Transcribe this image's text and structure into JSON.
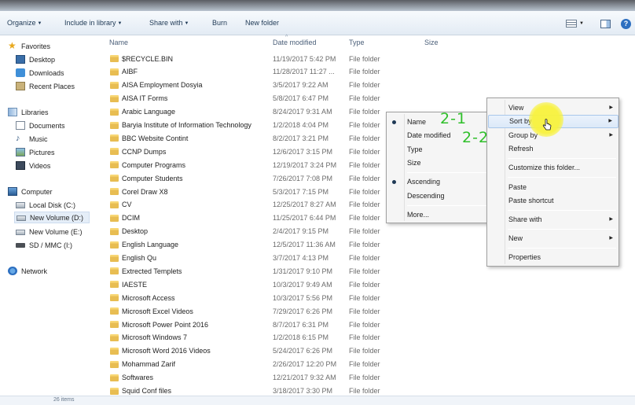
{
  "toolbar": {
    "organize": "Organize",
    "include_in_library": "Include in library",
    "share_with": "Share with",
    "burn": "Burn",
    "new_folder": "New folder"
  },
  "nav": {
    "favorites": "Favorites",
    "desktop": "Desktop",
    "downloads": "Downloads",
    "recent_places": "Recent Places",
    "libraries": "Libraries",
    "documents": "Documents",
    "music": "Music",
    "pictures": "Pictures",
    "videos": "Videos",
    "computer": "Computer",
    "local_disk": "Local Disk (C:)",
    "new_volume_d": "New Volume (D:)",
    "new_volume_e": "New Volume (E:)",
    "sd_mmc": "SD / MMC (I:)",
    "network": "Network"
  },
  "columns": {
    "name": "Name",
    "date_modified": "Date modified",
    "type": "Type",
    "size": "Size"
  },
  "files": [
    {
      "name": "$RECYCLE.BIN",
      "date": "11/19/2017 5:42 PM",
      "type": "File folder"
    },
    {
      "name": "AIBF",
      "date": "11/28/2017 11:27 ...",
      "type": "File folder"
    },
    {
      "name": "AISA Employment Dosyia",
      "date": "3/5/2017 9:22 AM",
      "type": "File folder"
    },
    {
      "name": "AISA IT Forms",
      "date": "5/8/2017 6:47 PM",
      "type": "File folder"
    },
    {
      "name": "Arabic Language",
      "date": "8/24/2017 9:31 AM",
      "type": "File folder"
    },
    {
      "name": "Baryia Institute of Information Technology",
      "date": "1/2/2018 4:04 PM",
      "type": "File folder"
    },
    {
      "name": "BBC Website Contint",
      "date": "8/2/2017 3:21 PM",
      "type": "File folder"
    },
    {
      "name": "CCNP Dumps",
      "date": "12/6/2017 3:15 PM",
      "type": "File folder"
    },
    {
      "name": "Computer Programs",
      "date": "12/19/2017 3:24 PM",
      "type": "File folder"
    },
    {
      "name": "Computer Students",
      "date": "7/26/2017 7:08 PM",
      "type": "File folder"
    },
    {
      "name": "Corel Draw X8",
      "date": "5/3/2017 7:15 PM",
      "type": "File folder"
    },
    {
      "name": "CV",
      "date": "12/25/2017 8:27 AM",
      "type": "File folder"
    },
    {
      "name": "DCIM",
      "date": "11/25/2017 6:44 PM",
      "type": "File folder"
    },
    {
      "name": "Desktop",
      "date": "2/4/2017 9:15 PM",
      "type": "File folder"
    },
    {
      "name": "English Language",
      "date": "12/5/2017 11:36 AM",
      "type": "File folder"
    },
    {
      "name": "English Qu",
      "date": "3/7/2017 4:13 PM",
      "type": "File folder"
    },
    {
      "name": "Extrected Templets",
      "date": "1/31/2017 9:10 PM",
      "type": "File folder"
    },
    {
      "name": "IAESTE",
      "date": "10/3/2017 9:49 AM",
      "type": "File folder"
    },
    {
      "name": "Microsoft Access",
      "date": "10/3/2017 5:56 PM",
      "type": "File folder"
    },
    {
      "name": "Microsoft Excel Videos",
      "date": "7/29/2017 6:26 PM",
      "type": "File folder"
    },
    {
      "name": "Microsoft Power Point 2016",
      "date": "8/7/2017 6:31 PM",
      "type": "File folder"
    },
    {
      "name": "Microsoft Windows 7",
      "date": "1/2/2018 6:15 PM",
      "type": "File folder"
    },
    {
      "name": "Microsoft Word 2016 Videos",
      "date": "5/24/2017 6:26 PM",
      "type": "File folder"
    },
    {
      "name": "Mohammad Zarif",
      "date": "2/26/2017 12:20 PM",
      "type": "File folder"
    },
    {
      "name": "Softwares",
      "date": "12/21/2017 9:32 AM",
      "type": "File folder"
    },
    {
      "name": "Squid Conf files",
      "date": "3/18/2017 3:30 PM",
      "type": "File folder"
    }
  ],
  "sort_menu": {
    "name": "Name",
    "date_modified": "Date modified",
    "type": "Type",
    "size": "Size",
    "ascending": "Ascending",
    "descending": "Descending",
    "more": "More...",
    "selected_field": "Name",
    "selected_order": "Ascending"
  },
  "context_menu": {
    "view": "View",
    "sort_by": "Sort by",
    "group_by": "Group by",
    "refresh": "Refresh",
    "customize": "Customize this folder...",
    "paste": "Paste",
    "paste_shortcut": "Paste shortcut",
    "share_with": "Share with",
    "new": "New",
    "properties": "Properties"
  },
  "annotations": {
    "step_1": "2-1",
    "step_2": "2-2"
  },
  "status": {
    "item_count": "26 items"
  },
  "colors": {
    "annotation_green": "#2fbf2a",
    "highlight_yellow": "#f8f23c",
    "toolbar_text": "#1e3955"
  },
  "icons": {
    "folder": "folder-icon",
    "favorites": "star-icon",
    "computer": "computer-icon",
    "network": "network-icon",
    "submenu": "chevron-right-icon"
  }
}
